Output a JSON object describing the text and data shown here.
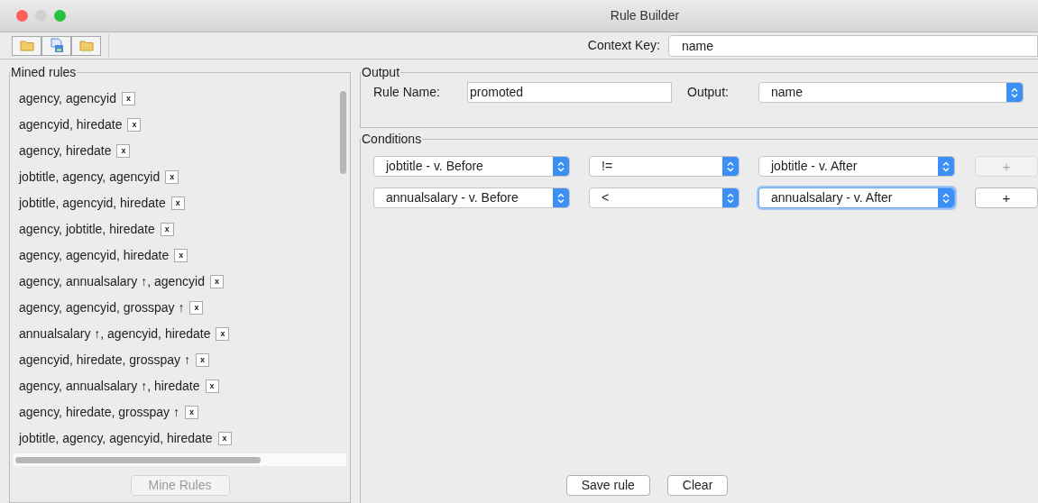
{
  "window": {
    "title": "Rule Builder"
  },
  "toolbar": {
    "buttons": [
      {
        "kind": "folder"
      },
      {
        "kind": "save"
      },
      {
        "kind": "folder"
      }
    ]
  },
  "context_key": {
    "label": "Context Key:",
    "value": "name"
  },
  "mined_rules": {
    "title": "Mined rules",
    "items": [
      {
        "label": "agency, agencyid",
        "remove": "x"
      },
      {
        "label": "agencyid, hiredate",
        "remove": "x"
      },
      {
        "label": "agency, hiredate",
        "remove": "x"
      },
      {
        "label": "jobtitle, agency, agencyid",
        "remove": "x"
      },
      {
        "label": "jobtitle, agencyid, hiredate",
        "remove": "x"
      },
      {
        "label": "agency, jobtitle, hiredate",
        "remove": "x"
      },
      {
        "label": "agency, agencyid, hiredate",
        "remove": "x"
      },
      {
        "label": "agency, annualsalary ↑, agencyid",
        "remove": "x"
      },
      {
        "label": "agency, agencyid, grosspay ↑",
        "remove": "x"
      },
      {
        "label": "annualsalary ↑, agencyid, hiredate",
        "remove": "x"
      },
      {
        "label": "agencyid, hiredate, grosspay ↑",
        "remove": "x"
      },
      {
        "label": "agency, annualsalary ↑, hiredate",
        "remove": "x"
      },
      {
        "label": "agency, hiredate, grosspay ↑",
        "remove": "x"
      },
      {
        "label": "jobtitle, agency, agencyid, hiredate",
        "remove": "x"
      }
    ],
    "button": {
      "label": "Mine Rules",
      "disabled": true
    }
  },
  "output": {
    "title": "Output",
    "rule_name_label": "Rule Name:",
    "rule_name": "promoted",
    "output_label": "Output:",
    "output_value": "name"
  },
  "conditions": {
    "title": "Conditions",
    "rows": [
      {
        "left": "jobtitle - v. Before",
        "operator": "!=",
        "right": "jobtitle - v. After",
        "right_focused": false,
        "add": "+",
        "add_disabled": true
      },
      {
        "left": "annualsalary - v. Before",
        "operator": "<",
        "right": "annualsalary - v. After",
        "right_focused": true,
        "add": "+",
        "add_disabled": false
      }
    ]
  },
  "buttons": [
    {
      "label": "Save rule"
    },
    {
      "label": "Clear"
    }
  ]
}
